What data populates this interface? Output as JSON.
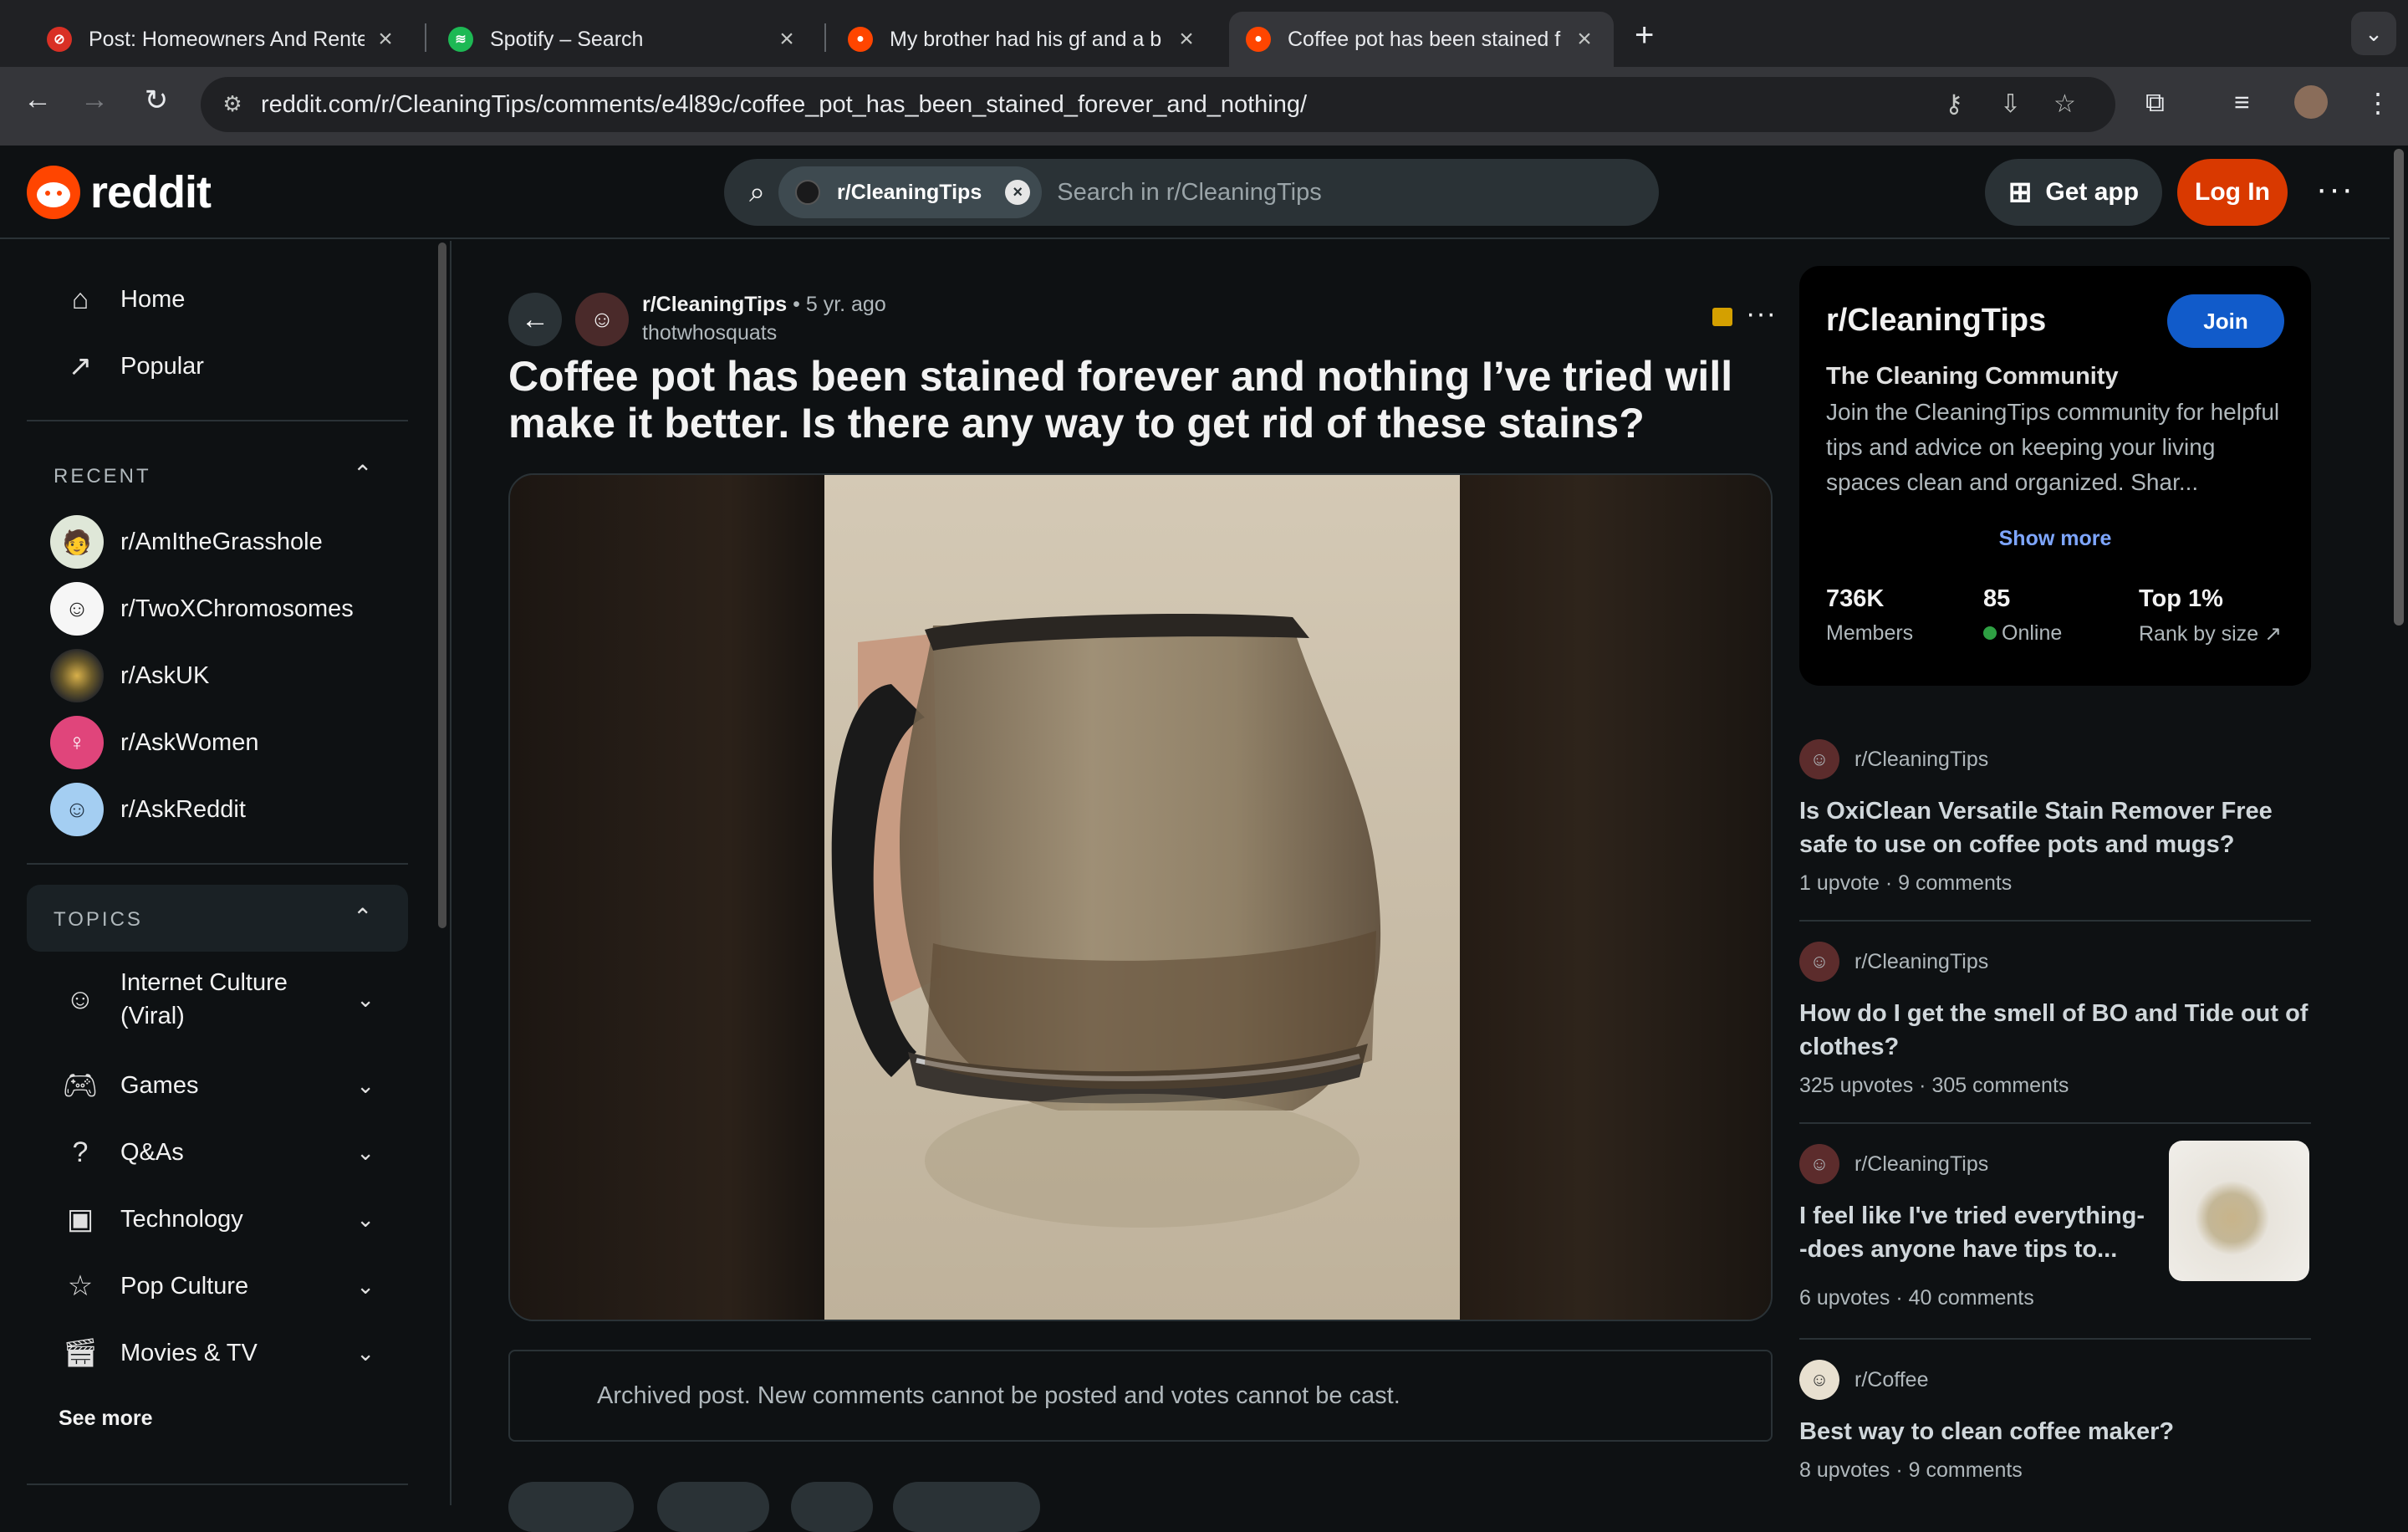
{
  "browser": {
    "tabs": [
      {
        "title": "Post: Homeowners And Rente",
        "favicon_color": "#d93025"
      },
      {
        "title": "Spotify – Search",
        "favicon_color": "#1db954"
      },
      {
        "title": "My brother had his gf and a b",
        "favicon_color": "#ff4500"
      },
      {
        "title": "Coffee pot has been stained f",
        "favicon_color": "#ff4500"
      }
    ],
    "new_tab": "+",
    "url": "reddit.com/r/CleaningTips/comments/e4l89c/coffee_pot_has_been_stained_forever_and_nothing/"
  },
  "header": {
    "logo_text": "reddit",
    "search_chip": "r/CleaningTips",
    "search_placeholder": "Search in r/CleaningTips",
    "get_app": "Get app",
    "login": "Log In"
  },
  "sidebar": {
    "nav": [
      {
        "label": "Home",
        "icon": "home-icon"
      },
      {
        "label": "Popular",
        "icon": "popular-icon"
      }
    ],
    "recent_heading": "RECENT",
    "recent": [
      {
        "label": "r/AmItheGrasshole",
        "color": "#dfe7d8"
      },
      {
        "label": "r/TwoXChromosomes",
        "color": "#f6f6f6"
      },
      {
        "label": "r/AskUK",
        "color": "#3a3a3a"
      },
      {
        "label": "r/AskWomen",
        "color": "#e0457b"
      },
      {
        "label": "r/AskReddit",
        "color": "#a4cef2"
      }
    ],
    "topics_heading": "TOPICS",
    "topics": [
      {
        "label": "Internet Culture",
        "label2": "(Viral)",
        "icon": "smile-icon"
      },
      {
        "label": "Games",
        "icon": "gamepad-icon"
      },
      {
        "label": "Q&As",
        "icon": "question-icon"
      },
      {
        "label": "Technology",
        "icon": "chip-icon"
      },
      {
        "label": "Pop Culture",
        "icon": "star-icon"
      },
      {
        "label": "Movies & TV",
        "icon": "clapper-icon"
      }
    ],
    "see_more": "See more"
  },
  "post": {
    "subreddit": "r/CleaningTips",
    "age": "• 5 yr. ago",
    "author": "thotwhosquats",
    "title": "Coffee pot has been stained forever and nothing I’ve tried will make it better. Is there any way to get rid of these stains?",
    "archived_notice": "Archived post. New comments cannot be posted and votes cannot be cast."
  },
  "community": {
    "name": "r/CleaningTips",
    "join": "Join",
    "title": "The Cleaning Community",
    "description": "Join the CleaningTips community for helpful tips and advice on keeping your living spaces clean and organized. Shar...",
    "show_more": "Show more",
    "stats": [
      {
        "value": "736K",
        "label": "Members"
      },
      {
        "value": "85",
        "label": "Online"
      },
      {
        "value": "Top 1%",
        "label": "Rank by size"
      }
    ]
  },
  "related": [
    {
      "sub": "r/CleaningTips",
      "title": "Is OxiClean Versatile Stain Remover Free safe to use on coffee pots and mugs?",
      "upvotes": "1 upvote",
      "comments": "9 comments"
    },
    {
      "sub": "r/CleaningTips",
      "title": "How do I get the smell of BO and Tide out of clothes?",
      "upvotes": "325 upvotes",
      "comments": "305 comments"
    },
    {
      "sub": "r/CleaningTips",
      "title": "I feel like I've tried everything--does anyone have tips to...",
      "upvotes": "6 upvotes",
      "comments": "40 comments"
    },
    {
      "sub": "r/Coffee",
      "title": "Best way to clean coffee maker?",
      "upvotes": "8 upvotes",
      "comments": "9 comments"
    }
  ]
}
